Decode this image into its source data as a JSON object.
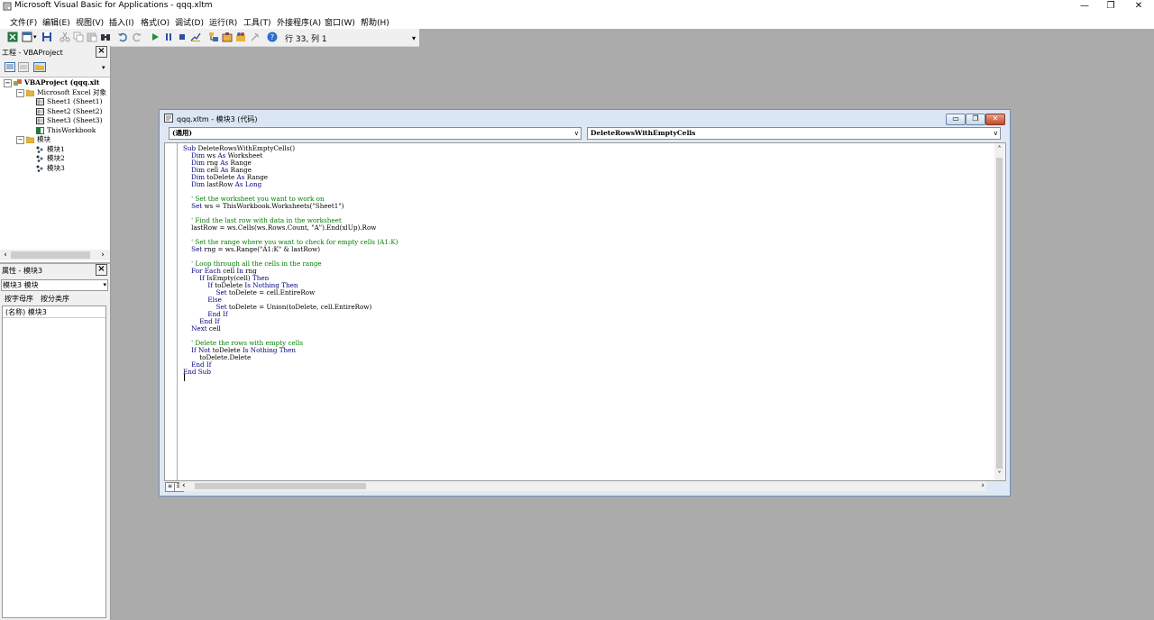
{
  "window": {
    "title": "Microsoft Visual Basic for Applications - qqq.xltm"
  },
  "menu": [
    "文件(F)",
    "编辑(E)",
    "视图(V)",
    "插入(I)",
    "格式(O)",
    "调试(D)",
    "运行(R)",
    "工具(T)",
    "外接程序(A)",
    "窗口(W)",
    "帮助(H)"
  ],
  "toolbar": {
    "position": "行 33, 列 1"
  },
  "project": {
    "title": "工程 - VBAProject",
    "nodes": [
      {
        "label": "VBAProject (qqq.xlt"
      },
      {
        "label": "Microsoft Excel 对象"
      },
      {
        "label": "Sheet1 (Sheet1)"
      },
      {
        "label": "Sheet2 (Sheet2)"
      },
      {
        "label": "Sheet3 (Sheet3)"
      },
      {
        "label": "ThisWorkbook"
      },
      {
        "label": "模块"
      },
      {
        "label": "模块1"
      },
      {
        "label": "模块2"
      },
      {
        "label": "模块3"
      }
    ]
  },
  "properties": {
    "title": "属性 - 模块3",
    "object_selected": "模块3 模块",
    "tabs": [
      "按字母序",
      "按分类序"
    ],
    "row_name": "(名称) 模块3"
  },
  "code_window": {
    "title": "qqq.xltm - 模块3 (代码)",
    "object_combo": "(通用)",
    "proc_combo": "DeleteRowsWithEmptyCells",
    "lines": [
      "Sub DeleteRowsWithEmptyCells()",
      "    Dim ws As Worksheet",
      "    Dim rng As Range",
      "    Dim cell As Range",
      "    Dim toDelete As Range",
      "    Dim lastRow As Long",
      "",
      "    ' Set the worksheet you want to work on",
      "    Set ws = ThisWorkbook.Worksheets(\"Sheet1\")",
      "",
      "    ' Find the last row with data in the worksheet",
      "    lastRow = ws.Cells(ws.Rows.Count, \"A\").End(xlUp).Row",
      "",
      "    ' Set the range where you want to check for empty cells (A1:K)",
      "    Set rng = ws.Range(\"A1:K\" & lastRow)",
      "",
      "    ' Loop through all the cells in the range",
      "    For Each cell In rng",
      "        If IsEmpty(cell) Then",
      "            If toDelete Is Nothing Then",
      "                Set toDelete = cell.EntireRow",
      "            Else",
      "                Set toDelete = Union(toDelete, cell.EntireRow)",
      "            End If",
      "        End If",
      "    Next cell",
      "",
      "    ' Delete the rows with empty cells",
      "    If Not toDelete Is Nothing Then",
      "        toDelete.Delete",
      "    End If",
      "End Sub",
      ""
    ]
  }
}
